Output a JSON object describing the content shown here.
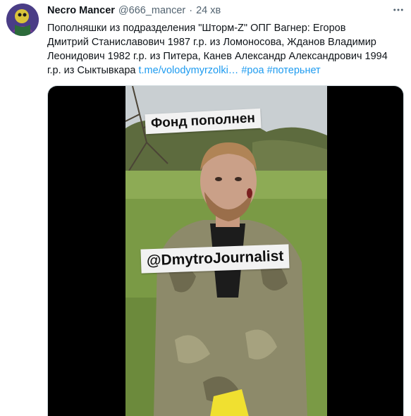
{
  "tweet": {
    "author_name": "Necro Mancer",
    "author_handle": "@666_mancer",
    "separator": "·",
    "timestamp": "24 хв",
    "text_line1": "Пополняшки из подразделения \"Шторм-Z\" ОПГ Вагнер: Егоров",
    "text_line2": "Дмитрий Станиславович 1987 г.р. из Ломоносова, Жданов Владимир",
    "text_line3": "Леонидович 1982 г.р. из Питера, Канев Александр Александрович 1994",
    "text_line4_prefix": "г.р. из Сыктывкара ",
    "link": "t.me/volodymyrzolki…",
    "hashtag1": "#роа",
    "hashtag2": "#потерьнет"
  },
  "media": {
    "caption_top": "Фонд пополнен",
    "caption_watermark": "@DmytroJournalist"
  },
  "icons": {
    "more": "more-dots-icon",
    "avatar": "avatar-image"
  },
  "colors": {
    "link": "#1d9bf0",
    "secondary_text": "#536471",
    "primary_text": "#0f1419"
  }
}
